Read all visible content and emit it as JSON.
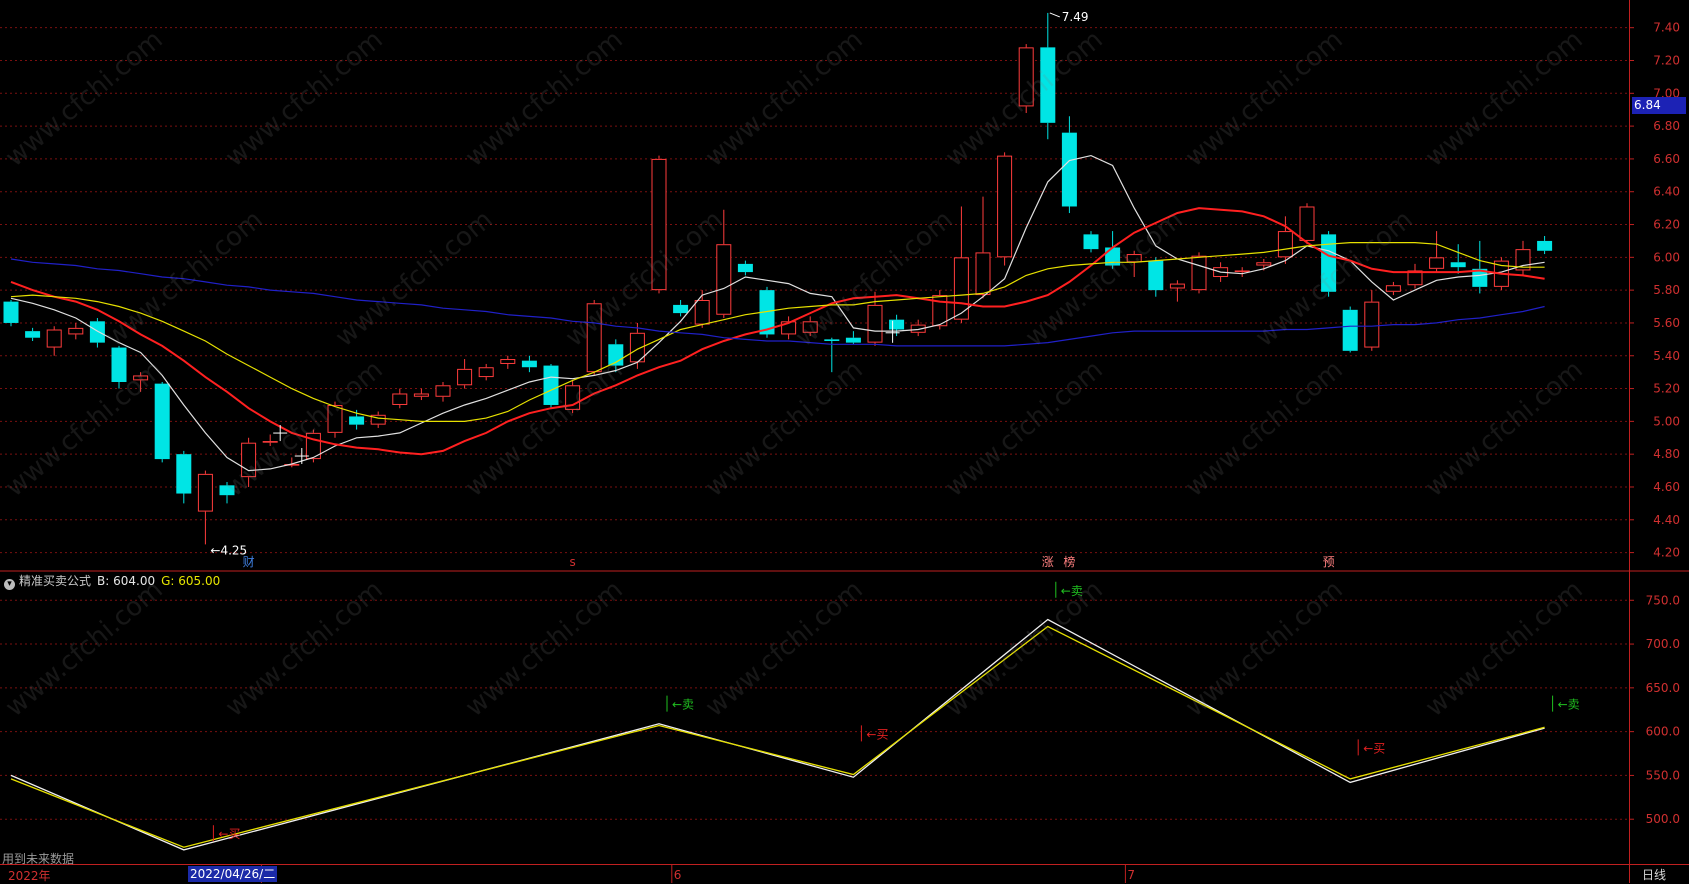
{
  "chart_data": {
    "type": "candlestick",
    "indicator_name": "精准买卖公式",
    "indicator_b_label": "B: 604.00",
    "indicator_g_label": "G: 605.00",
    "future_data_note": "用到未来数据",
    "current_price_label": "6.84",
    "period_label": "日线",
    "crosshair_date": "2022/04/26/二",
    "year_label": "2022年",
    "month_labels": [
      {
        "text": "5",
        "bar": 12
      },
      {
        "text": "6",
        "bar": 31
      },
      {
        "text": "7",
        "bar": 52
      }
    ],
    "event_labels": [
      {
        "text": "财",
        "bar": 11,
        "color": "#3f7fe0"
      },
      {
        "text": "s",
        "bar": 26,
        "color": "#d03030"
      },
      {
        "text": "涨",
        "bar": 48,
        "color": "#ff8080"
      },
      {
        "text": "榜",
        "bar": 49,
        "color": "#ff8080"
      },
      {
        "text": "预",
        "bar": 61,
        "color": "#ff8080"
      }
    ],
    "high_annotation": "7.49",
    "low_annotation": "4.25",
    "price_axis": {
      "min": 4.1,
      "max": 7.52,
      "ticks": [
        4.2,
        4.4,
        4.6,
        4.8,
        5.0,
        5.2,
        5.4,
        5.6,
        5.8,
        6.0,
        6.2,
        6.4,
        6.6,
        6.8,
        7.0,
        7.2,
        7.4
      ]
    },
    "price_tick_labels": [
      "4.20",
      "4.40",
      "4.60",
      "4.80",
      "5.00",
      "5.20",
      "5.40",
      "5.60",
      "5.80",
      "6.00",
      "6.20",
      "6.40",
      "6.60",
      "6.80",
      "7.00",
      "7.20",
      "7.40"
    ],
    "indicator_axis": {
      "min": 450,
      "max": 780,
      "ticks": [
        500,
        550,
        600,
        650,
        700,
        750
      ]
    },
    "indicator_tick_labels": [
      "500.0",
      "550.0",
      "600.0",
      "650.0",
      "700.0",
      "750.0"
    ],
    "candles": [
      [
        5.73,
        5.6,
        5.74,
        5.58
      ],
      [
        5.55,
        5.51,
        5.57,
        5.49
      ],
      [
        5.45,
        5.56,
        5.58,
        5.4
      ],
      [
        5.53,
        5.57,
        5.6,
        5.5
      ],
      [
        5.61,
        5.48,
        5.63,
        5.45
      ],
      [
        5.45,
        5.24,
        5.46,
        5.2
      ],
      [
        5.25,
        5.28,
        5.3,
        5.18
      ],
      [
        5.23,
        4.77,
        5.24,
        4.75
      ],
      [
        4.8,
        4.56,
        4.82,
        4.5
      ],
      [
        4.45,
        4.68,
        4.7,
        4.25
      ],
      [
        4.61,
        4.55,
        4.63,
        4.5
      ],
      [
        4.66,
        4.87,
        4.9,
        4.6
      ],
      [
        4.87,
        4.88,
        4.92,
        4.85
      ],
      [
        4.73,
        4.74,
        4.78,
        4.72
      ],
      [
        4.77,
        4.93,
        4.95,
        4.75
      ],
      [
        4.93,
        5.1,
        5.12,
        4.9
      ],
      [
        5.03,
        4.98,
        5.07,
        4.95
      ],
      [
        4.98,
        5.04,
        5.06,
        4.96
      ],
      [
        5.1,
        5.17,
        5.2,
        5.08
      ],
      [
        5.15,
        5.17,
        5.2,
        5.13
      ],
      [
        5.15,
        5.22,
        5.24,
        5.12
      ],
      [
        5.22,
        5.32,
        5.38,
        5.2
      ],
      [
        5.27,
        5.33,
        5.35,
        5.25
      ],
      [
        5.35,
        5.38,
        5.4,
        5.32
      ],
      [
        5.37,
        5.33,
        5.4,
        5.3
      ],
      [
        5.34,
        5.1,
        5.35,
        5.08
      ],
      [
        5.07,
        5.22,
        5.25,
        5.05
      ],
      [
        5.3,
        5.72,
        5.74,
        5.28
      ],
      [
        5.47,
        5.34,
        5.5,
        5.3
      ],
      [
        5.36,
        5.54,
        5.6,
        5.32
      ],
      [
        5.8,
        6.6,
        6.62,
        5.78
      ],
      [
        5.71,
        5.66,
        5.74,
        5.64
      ],
      [
        5.59,
        5.74,
        5.8,
        5.57
      ],
      [
        5.65,
        6.08,
        6.29,
        5.63
      ],
      [
        5.96,
        5.91,
        5.98,
        5.89
      ],
      [
        5.8,
        5.53,
        5.82,
        5.51
      ],
      [
        5.53,
        5.61,
        5.64,
        5.5
      ],
      [
        5.54,
        5.61,
        5.64,
        5.52
      ],
      [
        5.5,
        5.49,
        5.51,
        5.3
      ],
      [
        5.51,
        5.48,
        5.55,
        5.47
      ],
      [
        5.48,
        5.71,
        5.79,
        5.46
      ],
      [
        5.62,
        5.56,
        5.65,
        5.52
      ],
      [
        5.54,
        5.59,
        5.62,
        5.52
      ],
      [
        5.58,
        5.77,
        5.8,
        5.56
      ],
      [
        5.62,
        6.0,
        6.31,
        5.6
      ],
      [
        5.77,
        6.03,
        6.37,
        5.75
      ],
      [
        6.0,
        6.62,
        6.64,
        5.95
      ],
      [
        6.92,
        7.28,
        7.3,
        6.88
      ],
      [
        7.28,
        6.82,
        7.49,
        6.72
      ],
      [
        6.76,
        6.31,
        6.86,
        6.27
      ],
      [
        6.14,
        6.05,
        6.16,
        6.03
      ],
      [
        6.06,
        5.95,
        6.16,
        5.93
      ],
      [
        5.97,
        6.02,
        6.04,
        5.88
      ],
      [
        5.98,
        5.8,
        6.0,
        5.76
      ],
      [
        5.81,
        5.84,
        5.86,
        5.73
      ],
      [
        5.8,
        6.01,
        6.03,
        5.78
      ],
      [
        5.88,
        5.94,
        5.97,
        5.85
      ],
      [
        5.91,
        5.92,
        5.94,
        5.88
      ],
      [
        5.95,
        5.97,
        5.99,
        5.92
      ],
      [
        6.0,
        6.16,
        6.25,
        5.96
      ],
      [
        6.1,
        6.31,
        6.33,
        6.08
      ],
      [
        6.14,
        5.79,
        6.16,
        5.76
      ],
      [
        5.68,
        5.43,
        5.7,
        5.42
      ],
      [
        5.45,
        5.73,
        5.8,
        5.43
      ],
      [
        5.79,
        5.83,
        5.85,
        5.77
      ],
      [
        5.83,
        5.92,
        5.96,
        5.81
      ],
      [
        5.93,
        6.0,
        6.16,
        5.91
      ],
      [
        5.97,
        5.94,
        6.08,
        5.9
      ],
      [
        5.93,
        5.82,
        6.1,
        5.78
      ],
      [
        5.82,
        5.98,
        6.0,
        5.8
      ],
      [
        5.92,
        6.05,
        6.1,
        5.89
      ],
      [
        6.1,
        6.04,
        6.13,
        6.02
      ]
    ],
    "ma_series": [
      {
        "color": "#e0e0e0",
        "values": [
          5.75,
          5.72,
          5.68,
          5.63,
          5.55,
          5.48,
          5.42,
          5.28,
          5.1,
          4.93,
          4.78,
          4.7,
          4.71,
          4.74,
          4.78,
          4.85,
          4.9,
          4.91,
          4.93,
          4.99,
          5.05,
          5.1,
          5.14,
          5.19,
          5.24,
          5.27,
          5.26,
          5.28,
          5.31,
          5.36,
          5.48,
          5.61,
          5.77,
          5.81,
          5.88,
          5.86,
          5.84,
          5.78,
          5.76,
          5.57,
          5.55,
          5.55,
          5.56,
          5.59,
          5.66,
          5.76,
          5.87,
          6.18,
          6.46,
          6.59,
          6.62,
          6.56,
          6.3,
          6.07,
          5.99,
          5.95,
          5.91,
          5.9,
          5.93,
          5.98,
          6.07,
          6.04,
          5.98,
          5.85,
          5.74,
          5.8,
          5.86,
          5.88,
          5.89,
          5.91,
          5.95,
          5.97
        ]
      },
      {
        "color": "#ff2020",
        "values": [
          5.85,
          5.8,
          5.76,
          5.73,
          5.68,
          5.61,
          5.53,
          5.46,
          5.37,
          5.27,
          5.18,
          5.08,
          5.0,
          4.93,
          4.89,
          4.86,
          4.84,
          4.83,
          4.81,
          4.8,
          4.82,
          4.88,
          4.93,
          5.0,
          5.05,
          5.08,
          5.1,
          5.17,
          5.22,
          5.28,
          5.33,
          5.37,
          5.44,
          5.49,
          5.53,
          5.56,
          5.6,
          5.66,
          5.72,
          5.75,
          5.76,
          5.77,
          5.75,
          5.73,
          5.72,
          5.7,
          5.7,
          5.73,
          5.77,
          5.85,
          5.95,
          6.06,
          6.15,
          6.21,
          6.27,
          6.3,
          6.29,
          6.28,
          6.25,
          6.19,
          6.09,
          6.01,
          5.98,
          5.93,
          5.91,
          5.91,
          5.91,
          5.91,
          5.92,
          5.9,
          5.89,
          5.87
        ]
      },
      {
        "color": "#e6e000",
        "values": [
          5.76,
          5.77,
          5.76,
          5.75,
          5.73,
          5.7,
          5.66,
          5.61,
          5.55,
          5.49,
          5.41,
          5.34,
          5.27,
          5.2,
          5.14,
          5.09,
          5.05,
          5.02,
          5.01,
          5.0,
          5.0,
          5.0,
          5.02,
          5.06,
          5.13,
          5.19,
          5.25,
          5.3,
          5.36,
          5.44,
          5.5,
          5.56,
          5.59,
          5.62,
          5.65,
          5.67,
          5.69,
          5.7,
          5.71,
          5.71,
          5.73,
          5.74,
          5.75,
          5.76,
          5.77,
          5.78,
          5.82,
          5.89,
          5.93,
          5.95,
          5.96,
          5.97,
          5.97,
          5.98,
          5.99,
          6.0,
          6.01,
          6.02,
          6.03,
          6.05,
          6.07,
          6.08,
          6.09,
          6.09,
          6.09,
          6.09,
          6.08,
          6.03,
          5.98,
          5.95,
          5.94,
          5.94
        ]
      },
      {
        "color": "#2020c8",
        "values": [
          5.99,
          5.97,
          5.96,
          5.95,
          5.93,
          5.92,
          5.9,
          5.88,
          5.87,
          5.85,
          5.83,
          5.82,
          5.8,
          5.79,
          5.78,
          5.76,
          5.74,
          5.73,
          5.72,
          5.71,
          5.69,
          5.68,
          5.67,
          5.65,
          5.64,
          5.63,
          5.61,
          5.6,
          5.58,
          5.57,
          5.55,
          5.54,
          5.53,
          5.51,
          5.5,
          5.49,
          5.49,
          5.48,
          5.47,
          5.47,
          5.47,
          5.46,
          5.46,
          5.46,
          5.46,
          5.46,
          5.46,
          5.47,
          5.48,
          5.5,
          5.52,
          5.54,
          5.55,
          5.55,
          5.55,
          5.55,
          5.55,
          5.55,
          5.55,
          5.56,
          5.56,
          5.57,
          5.58,
          5.58,
          5.59,
          5.59,
          5.6,
          5.62,
          5.63,
          5.65,
          5.67,
          5.7
        ]
      }
    ],
    "indicator_series": [
      {
        "name": "B",
        "color": "#f0f0f0",
        "points": [
          [
            0,
            550
          ],
          [
            8,
            465
          ],
          [
            30,
            609
          ],
          [
            39,
            548
          ],
          [
            48,
            728
          ],
          [
            62,
            542
          ],
          [
            71,
            604
          ]
        ]
      },
      {
        "name": "G",
        "color": "#e6e000",
        "points": [
          [
            0,
            546
          ],
          [
            8,
            468
          ],
          [
            30,
            607
          ],
          [
            39,
            551
          ],
          [
            48,
            720
          ],
          [
            62,
            546
          ],
          [
            71,
            605
          ]
        ]
      }
    ],
    "signals": [
      {
        "text": "←卖",
        "bar": 48,
        "value": 762,
        "color": "#20c020"
      },
      {
        "text": "←卖",
        "bar": 30,
        "value": 632,
        "color": "#20c020"
      },
      {
        "text": "←卖",
        "bar": 71,
        "value": 632,
        "color": "#20c020"
      },
      {
        "text": "←买",
        "bar": 39,
        "value": 598,
        "color": "#e02020"
      },
      {
        "text": "←买",
        "bar": 62,
        "value": 582,
        "color": "#e02020"
      },
      {
        "text": "←买",
        "bar": 9,
        "value": 484,
        "color": "#e02020"
      }
    ]
  },
  "watermark_text": "www.cfchi.com"
}
